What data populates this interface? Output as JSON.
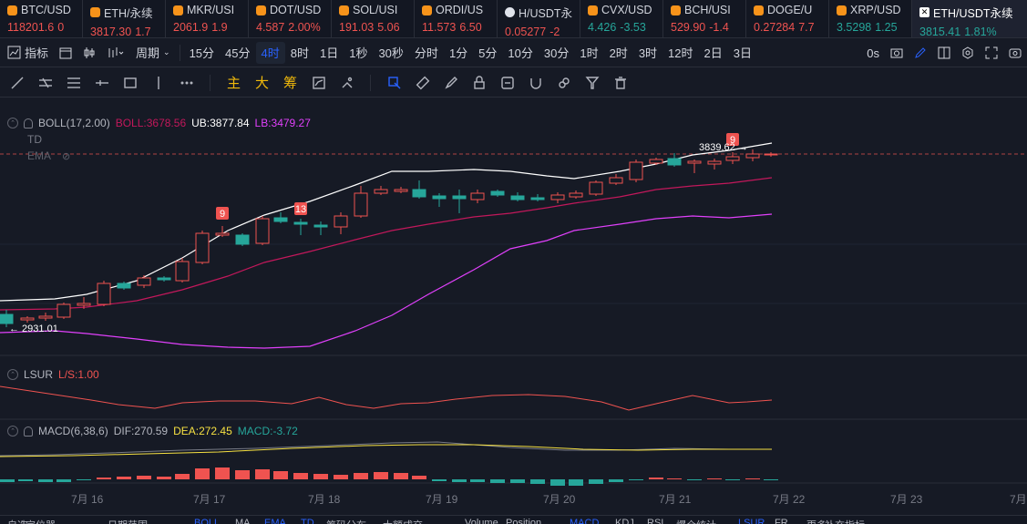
{
  "tickers": [
    {
      "name": "BTC/USD",
      "price": "118201.6",
      "change": "0",
      "dir": "down",
      "icon": "orange-dot-icon"
    },
    {
      "name": "ETH/永续",
      "price": "3817.30",
      "change": "1.7",
      "dir": "down",
      "icon": "orange-dot-icon"
    },
    {
      "name": "MKR/USI",
      "price": "2061.9",
      "change": "1.9",
      "dir": "down",
      "icon": "orange-dot-icon"
    },
    {
      "name": "DOT/USD",
      "price": "4.587",
      "change": "2.00%",
      "dir": "down",
      "icon": "orange-dot-icon"
    },
    {
      "name": "SOL/USI",
      "price": "191.03",
      "change": "5.06",
      "dir": "down",
      "icon": "orange-dot-icon"
    },
    {
      "name": "ORDI/US",
      "price": "11.573",
      "change": "6.50",
      "dir": "down",
      "icon": "orange-dot-icon"
    },
    {
      "name": "H/USDT永",
      "price": "0.05277",
      "change": "-2",
      "dir": "down",
      "icon": "white-dot-icon"
    },
    {
      "name": "CVX/USD",
      "price": "4.426",
      "change": "-3.53",
      "dir": "up",
      "icon": "orange-dot-icon"
    },
    {
      "name": "BCH/USI",
      "price": "529.90",
      "change": "-1.4",
      "dir": "down",
      "icon": "orange-dot-icon"
    },
    {
      "name": "DOGE/U",
      "price": "0.27284",
      "change": "7.7",
      "dir": "down",
      "icon": "orange-dot-icon"
    },
    {
      "name": "XRP/USD",
      "price": "3.5298",
      "change": "1.25",
      "dir": "up",
      "icon": "orange-dot-icon"
    },
    {
      "name": "ETH/USDT永续",
      "price": "3815.41",
      "change": "1.81%",
      "dir": "up",
      "icon": "x-logo-icon",
      "active": true
    }
  ],
  "toolbar1": {
    "indicators": "指标",
    "period": "周期",
    "intervals": [
      "15分",
      "45分",
      "4时",
      "8时",
      "1日",
      "1秒",
      "30秒",
      "分时",
      "1分",
      "5分",
      "10分",
      "30分",
      "1时",
      "2时",
      "3时",
      "12时",
      "2日",
      "3日"
    ],
    "active_interval": "4时",
    "countdown": "0s"
  },
  "toolbar2": {
    "main": "主",
    "big": "大",
    "chips": "筹"
  },
  "legends": {
    "boll_label": "BOLL(17,2.00)",
    "boll_mid": "BOLL:3678.56",
    "boll_ub": "UB:3877.84",
    "boll_lb": "LB:3479.27",
    "td": "TD",
    "ema": "EMA",
    "lsur": "LSUR",
    "lsur_val": "L/S:1.00",
    "macd": "MACD(6,38,6)",
    "dif": "DIF:270.59",
    "dea": "DEA:272.45",
    "macd_val": "MACD:-3.72"
  },
  "annotations": {
    "high_label": "3839.62",
    "low_label": "2931.01",
    "td_a": "9",
    "td_b": "13",
    "td_c": "9"
  },
  "x_axis": [
    "7月 16",
    "7月 17",
    "7月 18",
    "7月 19",
    "7月 20",
    "7月 21",
    "7月 22",
    "7月 23",
    "7月"
  ],
  "bottom_tabs": [
    "自选",
    "定位器",
    "日期范围",
    "BOLL",
    "MA",
    "EMA",
    "TD",
    "筹码分布",
    "大额成交",
    "Volume",
    "Position",
    "MACD",
    "KDJ",
    "RSI",
    "爆仓统计",
    "LSUR",
    "FR",
    "更多",
    "补充指标"
  ],
  "colors": {
    "up": "#26a69a",
    "down": "#ef5350",
    "accent": "#2962ff",
    "boll_mid": "#c2185b",
    "boll_band": "#e040fb",
    "upper": "#ffffff",
    "dea": "#f5e042"
  }
}
